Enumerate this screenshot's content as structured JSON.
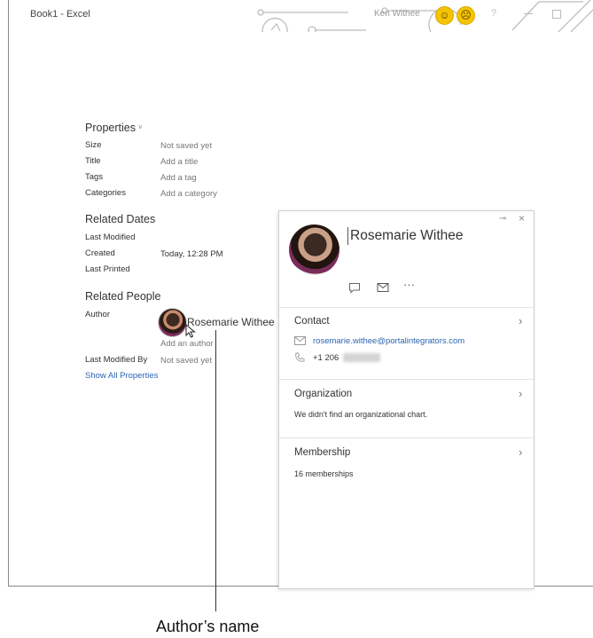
{
  "titlebar": {
    "app_title": "Book1  -  Excel",
    "user_name": "Ken Withee",
    "help": "?",
    "smile": "☺",
    "frown": "☹"
  },
  "properties": {
    "heading": "Properties",
    "caret": "˅",
    "rows": [
      {
        "label": "Size",
        "value": "Not saved yet"
      },
      {
        "label": "Title",
        "value": "Add a title"
      },
      {
        "label": "Tags",
        "value": "Add a tag"
      },
      {
        "label": "Categories",
        "value": "Add a category"
      }
    ]
  },
  "related_dates": {
    "heading": "Related Dates",
    "rows": [
      {
        "label": "Last Modified",
        "value": ""
      },
      {
        "label": "Created",
        "value": "Today, 12:28 PM"
      },
      {
        "label": "Last Printed",
        "value": ""
      }
    ]
  },
  "related_people": {
    "heading": "Related People",
    "author_label": "Author",
    "author_name": "Rosemarie Withee",
    "add_author": "Add an author",
    "last_modified_by_label": "Last Modified By",
    "last_modified_by_value": "Not saved yet",
    "show_all": "Show All Properties"
  },
  "contact_card": {
    "name": "Rosemarie Withee",
    "pin": "⊸",
    "close": "×",
    "more": "···",
    "contact": {
      "title": "Contact",
      "chevron": "›",
      "email": "rosemarie.withee@portalintegrators.com",
      "phone": "+1 206"
    },
    "organization": {
      "title": "Organization",
      "chevron": "›",
      "text": "We didn't find an organizational chart."
    },
    "membership": {
      "title": "Membership",
      "chevron": "›",
      "text": "16 memberships"
    }
  },
  "callout": "Author’s name",
  "colors": {
    "link": "#2b66b3",
    "smiley": "#f5c400"
  }
}
